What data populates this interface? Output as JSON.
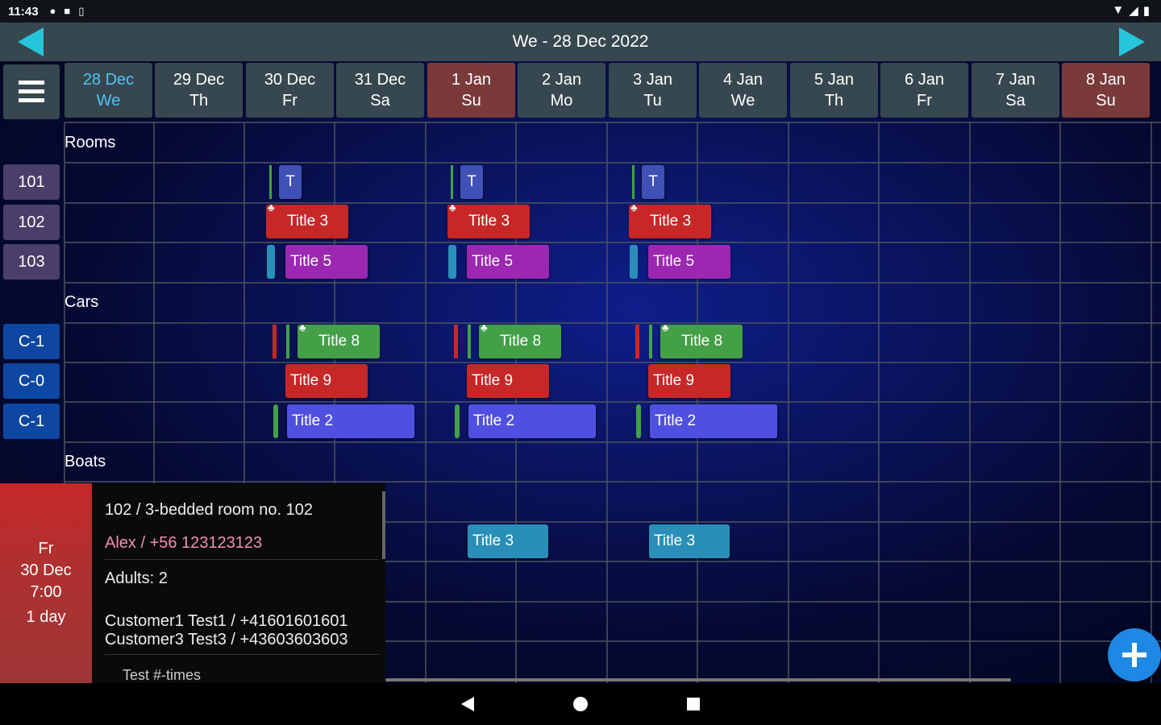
{
  "status": {
    "time": "11:43"
  },
  "header": {
    "title": "We - 28 Dec 2022"
  },
  "days": [
    {
      "date": "28 Dec",
      "dow": "We",
      "weekend": false,
      "today": true
    },
    {
      "date": "29 Dec",
      "dow": "Th",
      "weekend": false,
      "today": false
    },
    {
      "date": "30 Dec",
      "dow": "Fr",
      "weekend": false,
      "today": false
    },
    {
      "date": "31 Dec",
      "dow": "Sa",
      "weekend": false,
      "today": false
    },
    {
      "date": "1 Jan",
      "dow": "Su",
      "weekend": true,
      "today": false
    },
    {
      "date": "2 Jan",
      "dow": "Mo",
      "weekend": false,
      "today": false
    },
    {
      "date": "3 Jan",
      "dow": "Tu",
      "weekend": false,
      "today": false
    },
    {
      "date": "4 Jan",
      "dow": "We",
      "weekend": false,
      "today": false
    },
    {
      "date": "5 Jan",
      "dow": "Th",
      "weekend": false,
      "today": false
    },
    {
      "date": "6 Jan",
      "dow": "Fr",
      "weekend": false,
      "today": false
    },
    {
      "date": "7 Jan",
      "dow": "Sa",
      "weekend": false,
      "today": false
    },
    {
      "date": "8 Jan",
      "dow": "Su",
      "weekend": true,
      "today": false
    }
  ],
  "groups": {
    "rooms": "Rooms",
    "cars": "Cars",
    "boats": "Boats"
  },
  "rows": {
    "r101": "101",
    "r102": "102",
    "r103": "103",
    "c1a": "C-1",
    "c0": "C-0",
    "c1b": "C-1"
  },
  "events": {
    "t": "T",
    "title3": "Title 3",
    "title5": "Title 5",
    "title8": "Title 8",
    "title9": "Title 9",
    "title2": "Title 2"
  },
  "colors": {
    "red": "#c62828",
    "purple": "#9c27b0",
    "green": "#43a047",
    "indigo": "#3f51b5",
    "blue": "#5c5cf0",
    "teal": "#2a8fb8"
  },
  "popup": {
    "dow": "Fr",
    "date": "30 Dec",
    "time": "7:00",
    "duration": "1 day",
    "room": "102  /  3-bedded room no. 102",
    "contact": "Alex / +56 123123123",
    "adults": "Adults: 2",
    "customer1": "Customer1 Test1 / +41601601601",
    "customer3": "Customer3 Test3 / +43603603603",
    "more": "Test #-times"
  }
}
